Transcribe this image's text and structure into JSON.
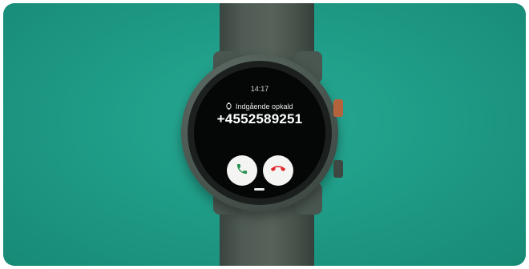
{
  "watch": {
    "time": "14:17",
    "call_status": "Indgående opkald",
    "caller_number": "+4552589251",
    "accept_icon": "phone-accept-icon",
    "decline_icon": "phone-decline-icon",
    "colors": {
      "background": "#1f9c87",
      "accept": "#1f8f4e",
      "decline": "#e0262b"
    }
  }
}
